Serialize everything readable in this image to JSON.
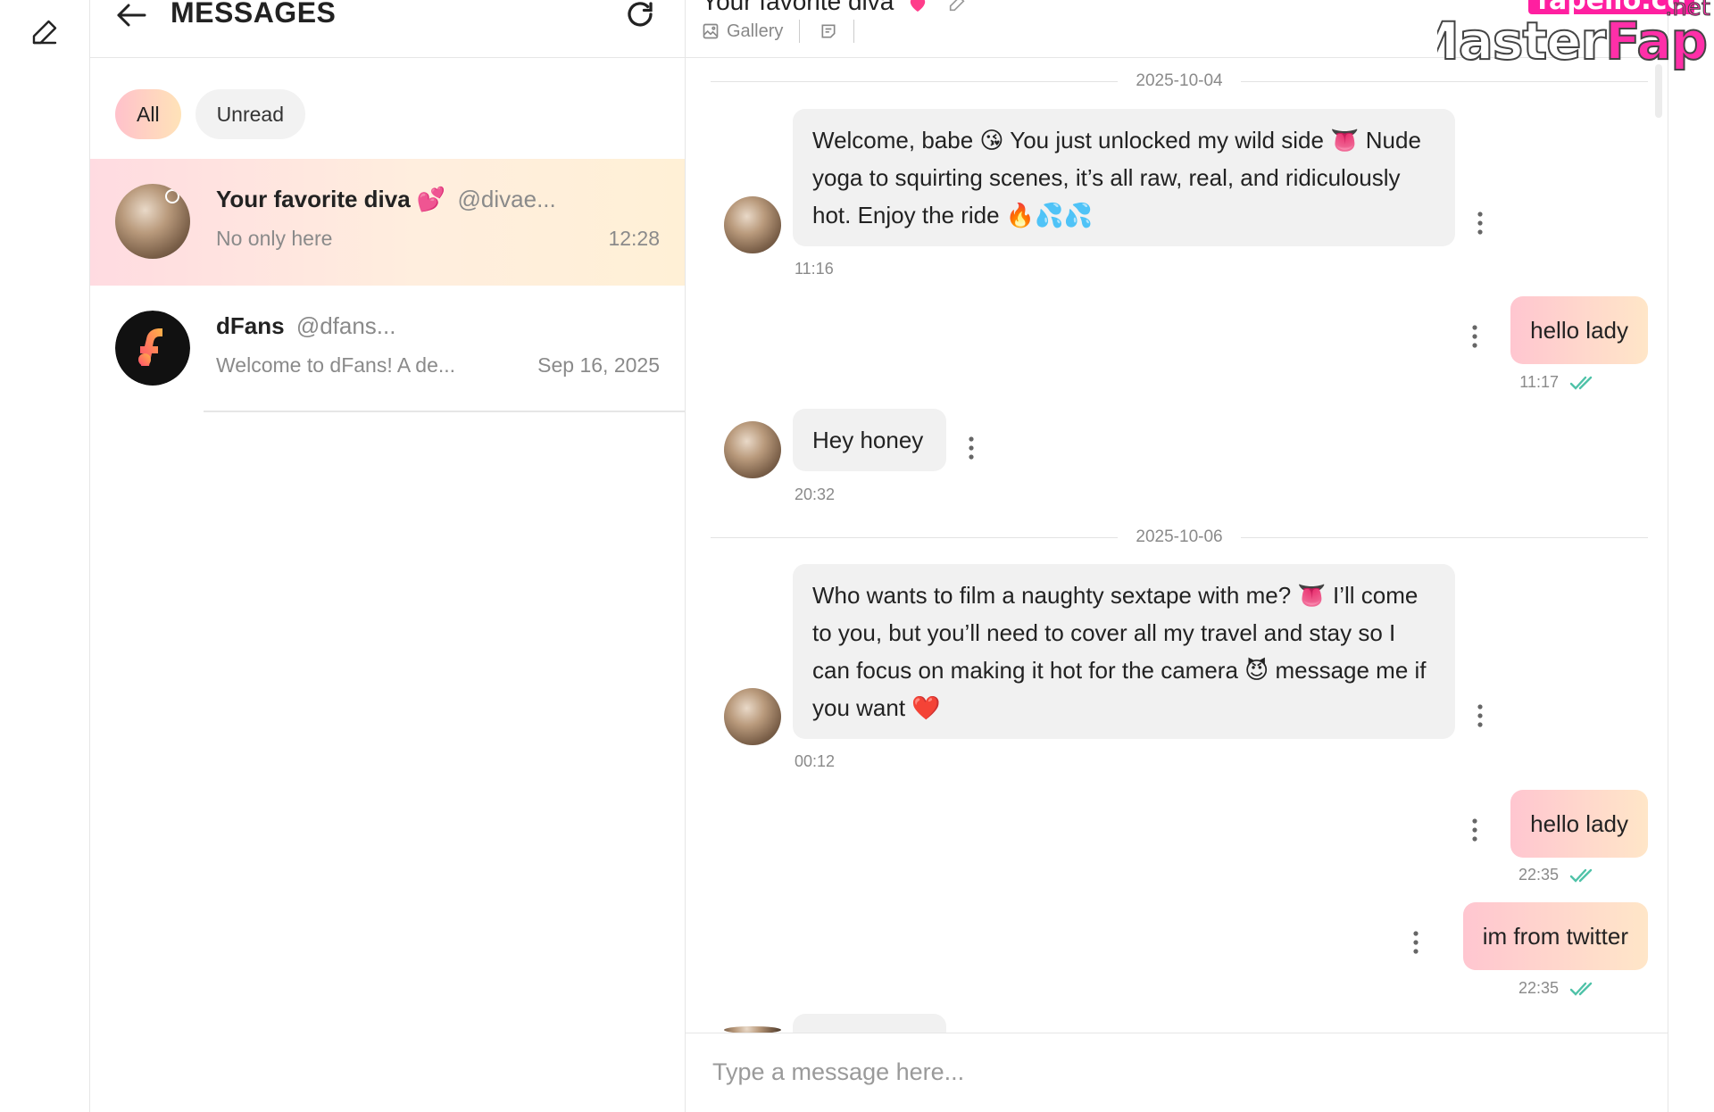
{
  "rail": {
    "compose_icon": "edit-pencil-icon"
  },
  "list": {
    "title": "MESSAGES",
    "filters": [
      {
        "label": "All",
        "active": true
      },
      {
        "label": "Unread",
        "active": false
      }
    ],
    "conversations": [
      {
        "name": "Your favorite diva",
        "name_emoji": "💕",
        "handle": "@divae...",
        "preview": "No only here",
        "time": "12:28",
        "selected": true
      },
      {
        "name": "dFans",
        "name_emoji": "",
        "handle": "@dfans...",
        "preview": "Welcome to dFans! A de...",
        "time": "Sep 16, 2025",
        "selected": false
      }
    ]
  },
  "chat": {
    "title": "Your favorite diva",
    "tabs": [
      {
        "label": "Gallery",
        "icon": "image-icon"
      },
      {
        "label": "",
        "icon": "note-icon"
      }
    ],
    "dates": [
      "2025-10-04",
      "2025-10-06"
    ],
    "messages": [
      {
        "dir": "in",
        "text": "Welcome, babe 😘 You just unlocked my wild side 👅 Nude yoga to squirting scenes, it’s all raw, real, and ridiculously hot. Enjoy the ride 🔥💦💦",
        "time": "11:16"
      },
      {
        "dir": "out",
        "text": "hello lady",
        "time": "11:17",
        "read": true
      },
      {
        "dir": "in",
        "text": "Hey honey",
        "time": "20:32"
      },
      {
        "dir": "in",
        "text": "Who wants to film a naughty sextape with me? 👅 I’ll come to you, but you’ll need to cover all my travel and stay so I can focus on making it hot for the camera 😈 message me if you want ❤️",
        "time": "00:12"
      },
      {
        "dir": "out",
        "text": "hello lady",
        "time": "22:35",
        "read": true
      },
      {
        "dir": "out",
        "text": "im from twitter",
        "time": "22:35",
        "read": true
      }
    ],
    "composer_placeholder": "Type a message here..."
  },
  "watermark": {
    "top": "fapello.co",
    "main_a": "Master",
    "main_b": "Fap",
    "suffix": ".net"
  },
  "colors": {
    "accent_pink": "#ffc6d0",
    "accent_peach": "#ffe6c8",
    "read_check": "#4fc2a8",
    "watermark_pink": "#ff2fa8"
  }
}
